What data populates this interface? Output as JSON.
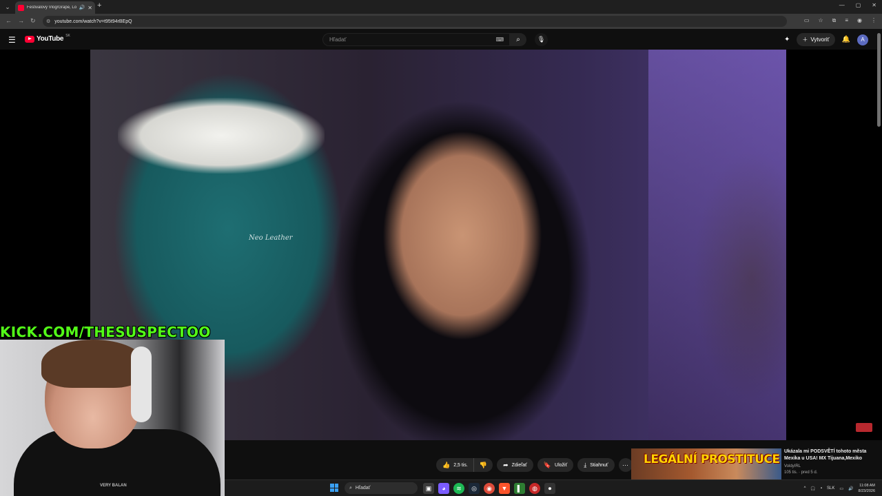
{
  "browser": {
    "tab_title": "Festivalový Vlog/Grape, Lo",
    "url": "youtube.com/watch?v=t95t94rBEpQ"
  },
  "youtube": {
    "logo_text": "YouTube",
    "country_code": "SK",
    "search_placeholder": "Hľadať",
    "create_label": "Vytvoriť",
    "avatar_letter": "A"
  },
  "video": {
    "shirt_text": "Neo Leather"
  },
  "overlay": {
    "kick_banner": "KICK.COM/THESUSPECTOO",
    "webcam_shirt_text": "VERY BALAN"
  },
  "actions": {
    "like_count": "2,5 tis.",
    "share_label": "Zdieľať",
    "save_label": "Uložiť",
    "download_label": "Stiahnuť"
  },
  "recommendation": {
    "thumb_text": "LEGÁLNÍ PROSTITUCE",
    "title": "Ukázala mi PODSVĚTÍ tohoto města Mexika u USA! MX Tijuana,Mexiko",
    "channel": "VoldyIRL",
    "meta": "105 tis. · pred 5 d."
  },
  "taskbar": {
    "search_label": "Hľadať",
    "language": "SLK",
    "time": "11:08 AM",
    "date": "8/23/2026"
  },
  "colors": {
    "kick_green": "#53fc18",
    "youtube_red": "#ff0033",
    "youtube_bg": "#0f0f0f"
  }
}
